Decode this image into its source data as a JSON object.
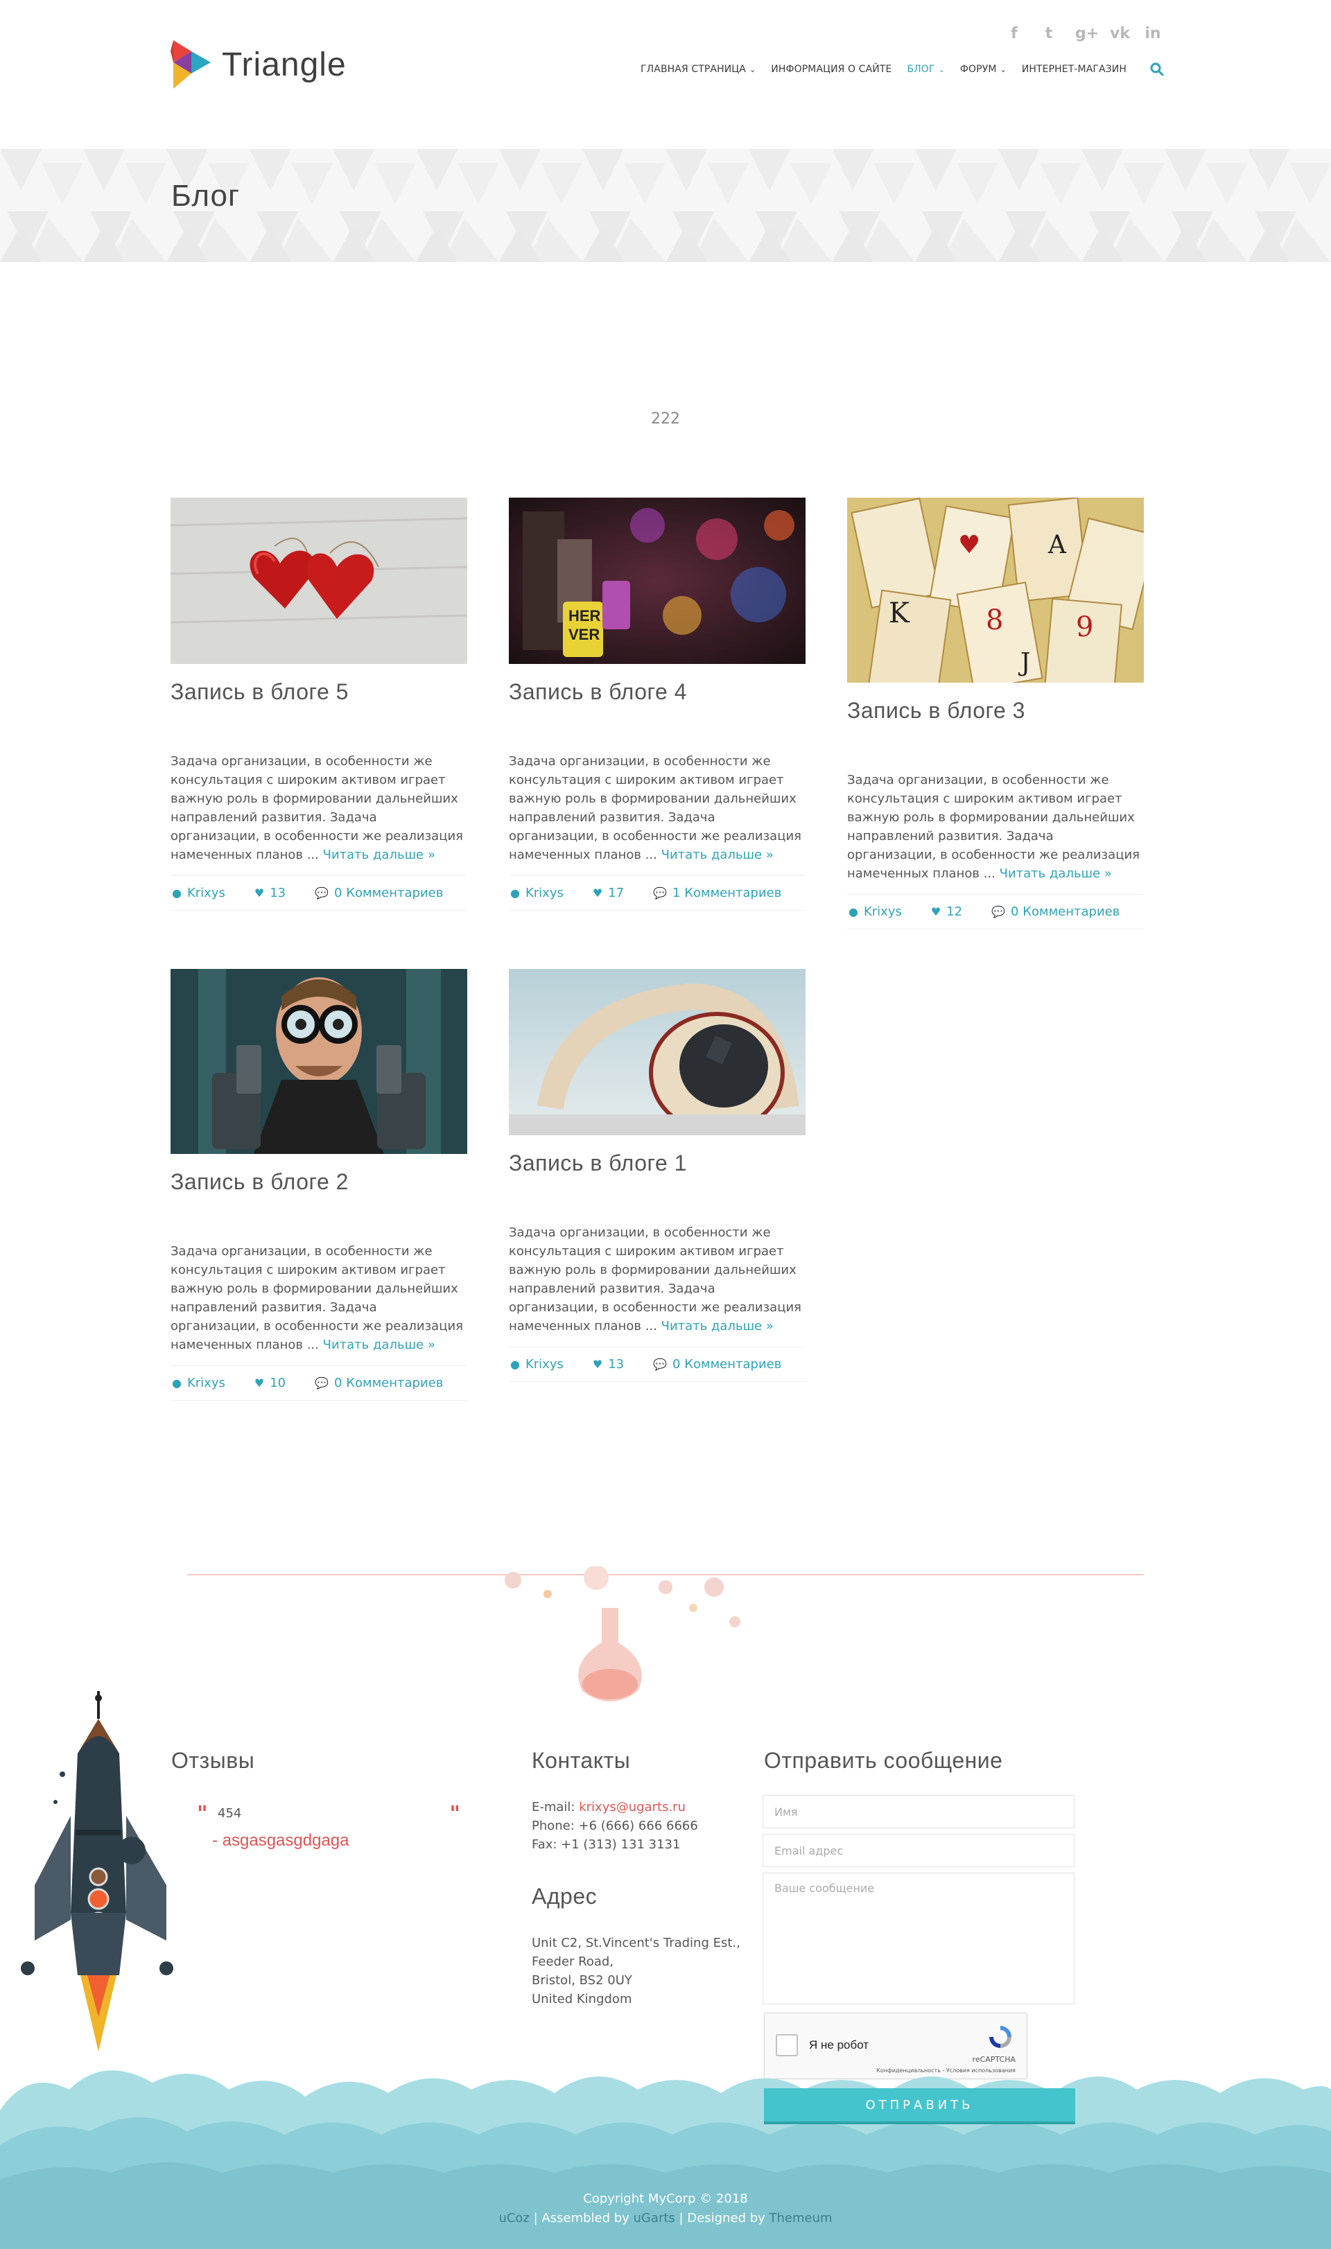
{
  "header": {
    "logo_text": "Triangle",
    "social_icons": [
      "facebook-icon",
      "twitter-icon",
      "google-plus-icon",
      "vk-icon",
      "linkedin-icon"
    ],
    "social_glyphs": [
      "f",
      "t",
      "g+",
      "vk",
      "in"
    ],
    "nav": [
      {
        "label": "ГЛАВНАЯ СТРАНИЦА",
        "dropdown": true,
        "active": false
      },
      {
        "label": "ИНФОРМАЦИЯ О САЙТЕ",
        "dropdown": false,
        "active": false
      },
      {
        "label": "БЛОГ",
        "dropdown": true,
        "active": true
      },
      {
        "label": "ФОРУМ",
        "dropdown": true,
        "active": false
      },
      {
        "label": "ИНТЕРНЕТ-МАГАЗИН",
        "dropdown": false,
        "active": false
      }
    ]
  },
  "page": {
    "title": "Блог",
    "intro": "222"
  },
  "posts": [
    {
      "title": "Запись в блоге 5",
      "body": "Задача организации, в особенности же консультация с широким активом играет важную роль в формировании дальнейших направлений развития. Задача организации, в особенности же реализация намеченных планов ...",
      "more": "Читать дальше »",
      "author": "Krixys",
      "likes": "13",
      "comments": "0 Комментариев",
      "image": "hearts"
    },
    {
      "title": "Запись в блоге 4",
      "body": "Задача организации, в особенности же консультация с широким активом играет важную роль в формировании дальнейших направлений развития. Задача организации, в особенности же реализация намеченных планов ...",
      "more": "Читать дальше »",
      "author": "Krixys",
      "likes": "17",
      "comments": "1 Комментариев",
      "image": "locks"
    },
    {
      "title": "Запись в блоге 3",
      "body": "Задача организации, в особенности же консультация с широким активом играет важную роль в формировании дальнейших направлений развития. Задача организации, в особенности же реализация намеченных планов ...",
      "more": "Читать дальше »",
      "author": "Krixys",
      "likes": "12",
      "comments": "0 Комментариев",
      "image": "cards"
    },
    {
      "title": "Запись в блоге 2",
      "body": "Задача организации, в особенности же консультация с широким активом играет важную роль в формировании дальнейших направлений развития. Задача организации, в особенности же реализация намеченных планов ...",
      "more": "Читать дальше »",
      "author": "Krixys",
      "likes": "10",
      "comments": "0 Комментариев",
      "image": "guns"
    },
    {
      "title": "Запись в блоге 1",
      "body": "Задача организации, в особенности же консультация с широким активом играет важную роль в формировании дальнейших направлений развития. Задача организации, в особенности же реализация намеченных планов ...",
      "more": "Читать дальше »",
      "author": "Krixys",
      "likes": "13",
      "comments": "0 Комментариев",
      "image": "headphones"
    }
  ],
  "footer": {
    "reviews_title": "Отзывы",
    "review_text": "454",
    "review_author": "- asgasgasgdgaga",
    "contacts_title": "Контакты",
    "email_label": "E-mail:",
    "email": "krixys@ugarts.ru",
    "phone": "Phone: +6 (666) 666 6666",
    "fax": "Fax: +1 (313) 131 3131",
    "address_title": "Адрес",
    "address_lines": [
      "Unit C2, St.Vincent's Trading Est.,",
      "Feeder Road,",
      "Bristol, BS2 0UY",
      "United Kingdom"
    ],
    "form_title": "Отправить сообщение",
    "name_placeholder": "Имя",
    "email_placeholder": "Email адрес",
    "message_placeholder": "Ваше сообщение",
    "captcha_label": "Я не робот",
    "captcha_brand": "reCAPTCHA",
    "captcha_links": "Конфиденциальность - Условия использования",
    "submit": "ОТПРАВИТЬ",
    "copyright": "Copyright MyCorp © 2018",
    "credit_ucoz": "uCoz",
    "credit_assembled": "Assembled by",
    "credit_ugarts": "uGarts",
    "credit_designed": "Designed by",
    "credit_themeum": "Themeum",
    "sep": "|"
  },
  "colors": {
    "accent": "#2ea3b8",
    "red": "#e05454",
    "cloud": "#8fd0da",
    "submit": "#44c4cc"
  }
}
